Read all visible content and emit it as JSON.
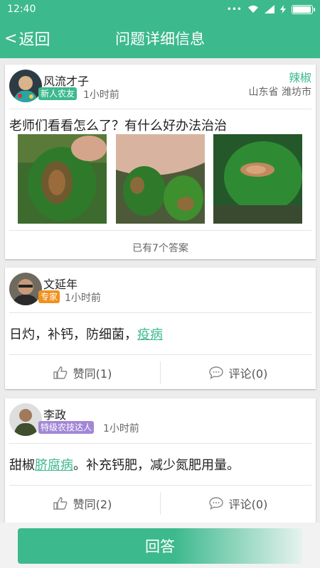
{
  "status_bar": {
    "time": "12:40",
    "dots": "•••",
    "battery_level": 1.0
  },
  "nav": {
    "back_label": "返回",
    "title": "问题详细信息"
  },
  "question": {
    "user_name": "风流才子",
    "badge": "新人农友",
    "time": "1小时前",
    "crop": "辣椒",
    "location": "山东省 潍坊市",
    "text": "老师们看看怎么了？有什么好办法治治",
    "photos_count": 3,
    "answer_count": "已有7个答案"
  },
  "answers": [
    {
      "user_name": "文延年",
      "badge": "专家",
      "time": "1小时前",
      "text_plain": "日灼，补钙，防细菌，",
      "text_link": "疫病",
      "text_after": "",
      "like_label": "赞同(1)",
      "comment_label": "评论(0)"
    },
    {
      "user_name": "李政",
      "badge": "特级农技达人",
      "time": "1小时前",
      "text_plain": "甜椒",
      "text_link": "脐腐病",
      "text_after": "。补充钙肥，减少氮肥用量。",
      "like_label": "赞同(2)",
      "comment_label": "评论(0)"
    }
  ],
  "bottom": {
    "answer_button": "回答"
  },
  "colors": {
    "primary": "#3db98e",
    "expert_badge": "#f0911f",
    "master_badge": "#a387d6"
  }
}
